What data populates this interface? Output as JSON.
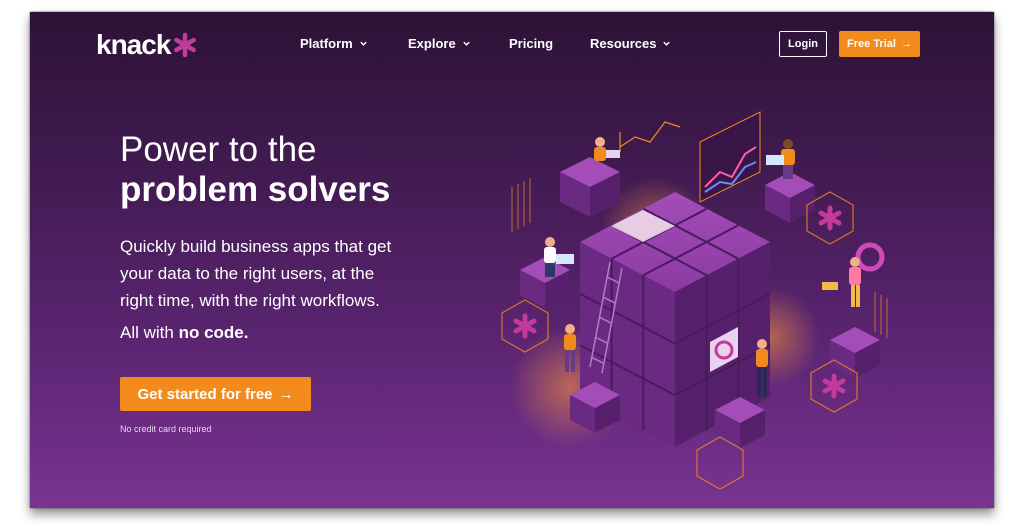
{
  "brand": {
    "logo_text": "knack",
    "accent": "#f28a1c",
    "star_color": "#c13a9c"
  },
  "nav": {
    "items": [
      {
        "label": "Platform",
        "has_dropdown": true
      },
      {
        "label": "Explore",
        "has_dropdown": true
      },
      {
        "label": "Pricing",
        "has_dropdown": false
      },
      {
        "label": "Resources",
        "has_dropdown": true
      }
    ],
    "login_label": "Login",
    "trial_label": "Free Trial",
    "trial_icon": "arrow-right-icon"
  },
  "hero": {
    "title_line1": "Power to the",
    "title_line2": "problem solvers",
    "subtitle_lines": [
      "Quickly build business apps that get",
      "your data to the right users, at the",
      "right time, with the right workflows."
    ],
    "nocode_prefix": "All with ",
    "nocode_bold": "no code.",
    "cta_label": "Get started for free",
    "cta_icon": "arrow-right-icon",
    "fineprint": "No credit card required"
  },
  "illustration": {
    "name": "isometric-cube-illustration"
  }
}
